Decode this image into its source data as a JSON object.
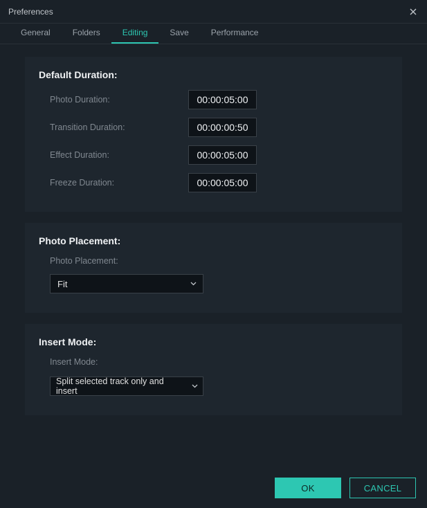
{
  "window": {
    "title": "Preferences"
  },
  "tabs": [
    {
      "label": "General"
    },
    {
      "label": "Folders"
    },
    {
      "label": "Editing"
    },
    {
      "label": "Save"
    },
    {
      "label": "Performance"
    }
  ],
  "sections": {
    "duration": {
      "title": "Default Duration:",
      "fields": [
        {
          "label": "Photo Duration:",
          "value": "00:00:05:00"
        },
        {
          "label": "Transition Duration:",
          "value": "00:00:00:50"
        },
        {
          "label": "Effect Duration:",
          "value": "00:00:05:00"
        },
        {
          "label": "Freeze Duration:",
          "value": "00:00:05:00"
        }
      ]
    },
    "placement": {
      "title": "Photo Placement:",
      "sublabel": "Photo Placement:",
      "value": "Fit"
    },
    "insert": {
      "title": "Insert Mode:",
      "sublabel": "Insert Mode:",
      "value": "Split selected track only and insert"
    }
  },
  "buttons": {
    "ok": "OK",
    "cancel": "CANCEL"
  }
}
